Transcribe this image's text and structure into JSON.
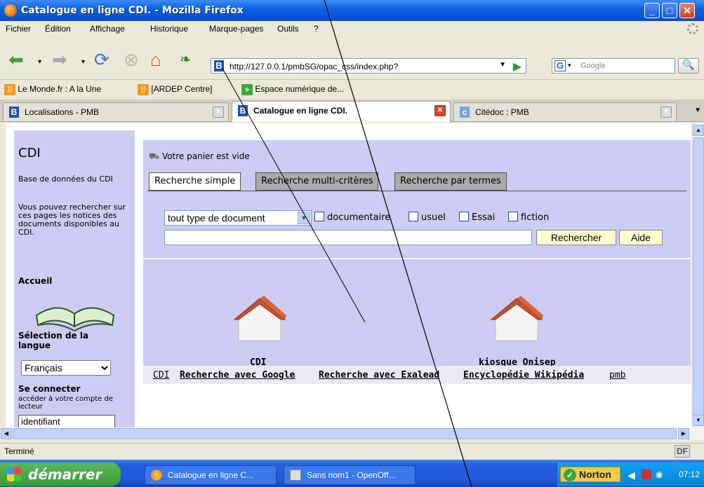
{
  "window": {
    "title": "Catalogue en ligne CDI. - Mozilla Firefox"
  },
  "menu": [
    "Fichier",
    "Édition",
    "Affichage",
    "Historique",
    "Marque-pages",
    "Outils",
    "?"
  ],
  "nav": {
    "url": "http://127.0.0.1/pmbSG/opac_css/index.php?",
    "search_placeholder": "Google"
  },
  "bookmarks": [
    "Le Monde.fr : A la Une",
    "[ARDEP Centre]",
    "Espace numérique de..."
  ],
  "tabs": [
    "Localisations - PMB",
    "Catalogue en ligne CDI.",
    "Citédoc : PMB"
  ],
  "sidebar": {
    "title": "CDI",
    "db": "Base de données du CDI",
    "desc": "Vous pouvez rechercher sur ces pages les notices des documents disponibles au CDI.",
    "home": "Accueil",
    "lang_heading": "Sélection de la langue",
    "lang_value": "Français",
    "connect": "Se connecter",
    "connect_hint": "accéder à votre compte de lecteur",
    "id_value": "identifiant"
  },
  "main": {
    "cart": "Votre panier est vide",
    "search_tabs": [
      "Recherche simple",
      "Recherche multi-critères",
      "Recherche par termes"
    ],
    "doc_type": "tout type de document",
    "checkboxes": [
      "documentaire",
      "usuel",
      "Essai",
      "fiction"
    ],
    "search_button": "Rechercher",
    "help_button": "Aide",
    "homes": [
      "CDI",
      "kiosque Onisep"
    ],
    "footer_links": [
      "CDI",
      "Recherche avec Google",
      "Recherche avec Exalead",
      "Encyclopédie Wikipédia",
      "pmb"
    ]
  },
  "status": {
    "text": "Terminé",
    "df": "DF"
  },
  "taskbar": {
    "start": "démarrer",
    "tasks": [
      "Catalogue en ligne C...",
      "Sans nom1 - OpenOff..."
    ],
    "norton": "Norton",
    "clock": "07:12"
  },
  "colors": {
    "panel": "#ccccf4",
    "titlebar": "#0a5fe0"
  }
}
